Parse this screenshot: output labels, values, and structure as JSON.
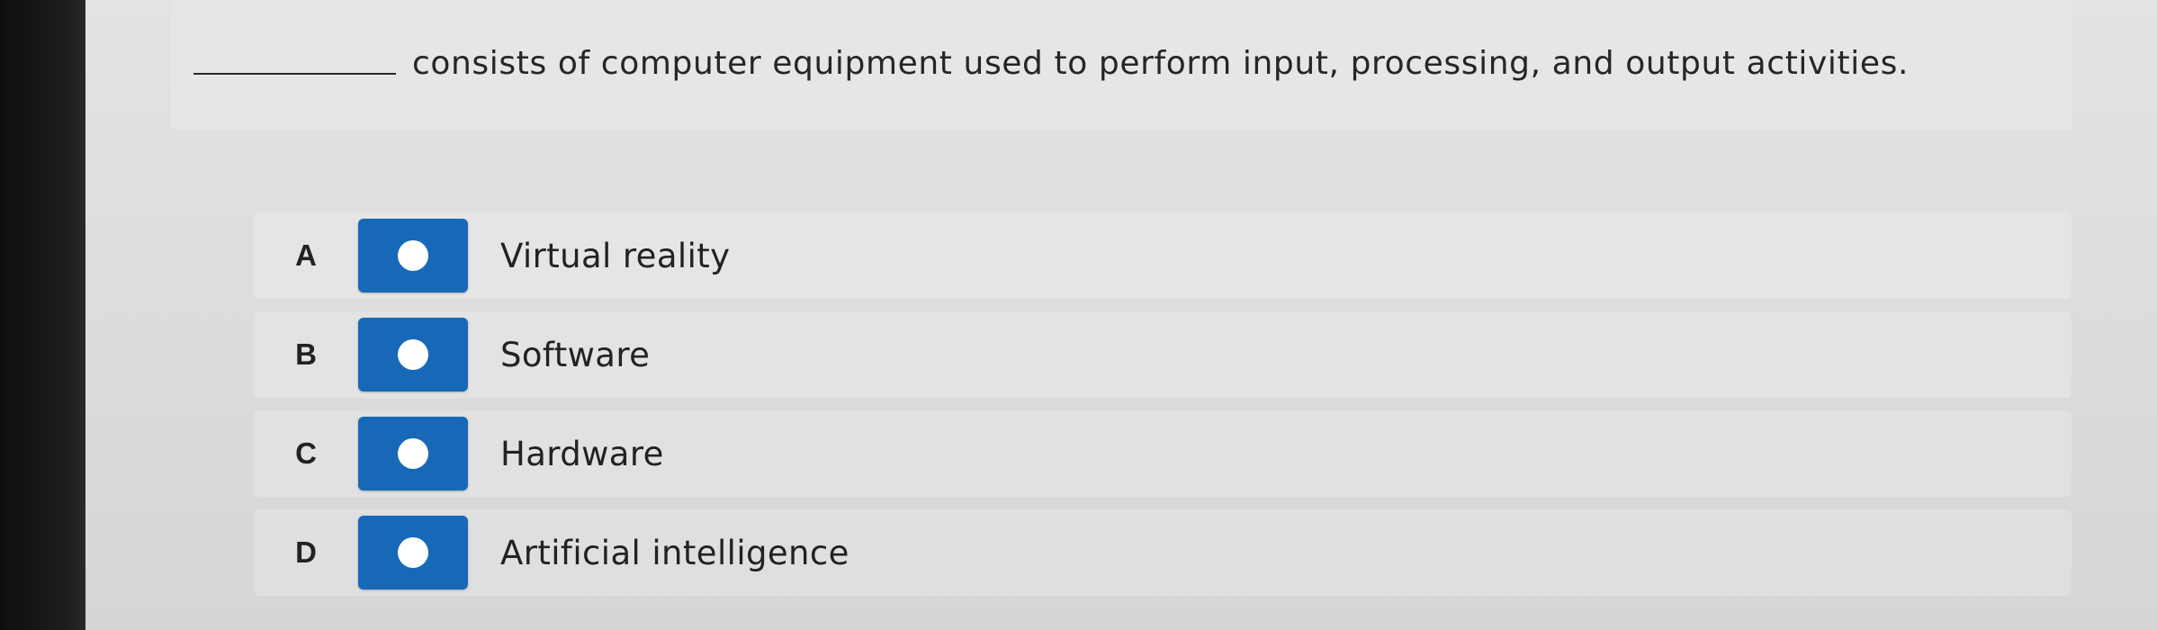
{
  "question": {
    "blank": "",
    "text": "consists of computer equipment used to perform input, processing, and output activities."
  },
  "options": [
    {
      "letter": "A",
      "label": "Virtual reality",
      "icon": "radio-button-icon"
    },
    {
      "letter": "B",
      "label": "Software",
      "icon": "radio-button-icon"
    },
    {
      "letter": "C",
      "label": "Hardware",
      "icon": "radio-button-icon"
    },
    {
      "letter": "D",
      "label": "Artificial intelligence",
      "icon": "radio-button-icon"
    }
  ],
  "colors": {
    "radio_fill": "#1769b8",
    "radio_dot": "#ffffff",
    "background": "#e3e3e3"
  }
}
